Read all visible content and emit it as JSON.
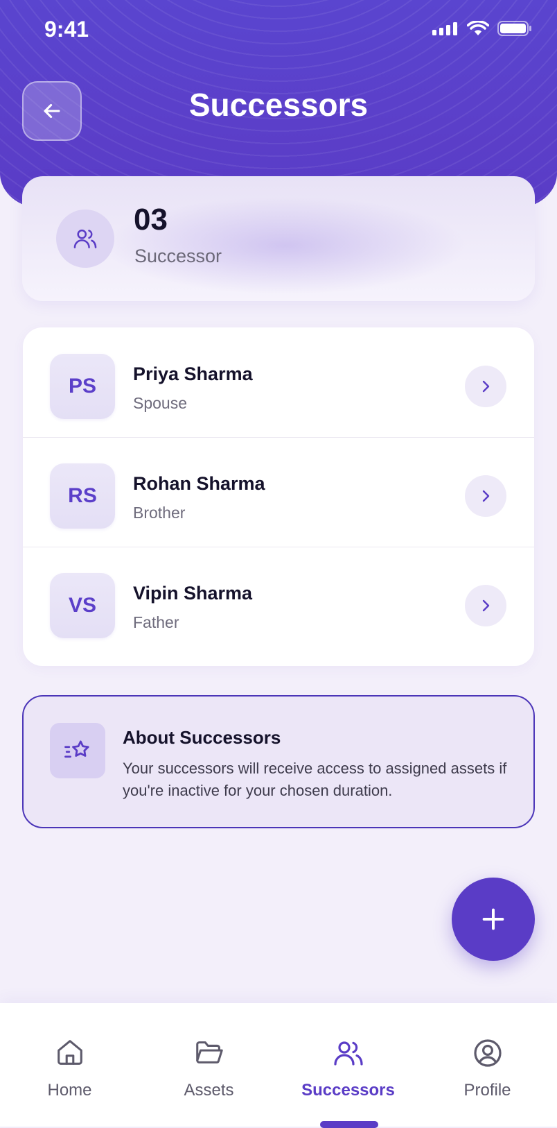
{
  "status_bar": {
    "time": "9:41"
  },
  "header": {
    "title": "Successors"
  },
  "summary": {
    "count": "03",
    "label": "Successor"
  },
  "successors": [
    {
      "initials": "PS",
      "name": "Priya Sharma",
      "relation": "Spouse"
    },
    {
      "initials": "RS",
      "name": "Rohan Sharma",
      "relation": "Brother"
    },
    {
      "initials": "VS",
      "name": "Vipin Sharma",
      "relation": "Father"
    }
  ],
  "about": {
    "title": "About Successors",
    "text": "Your successors will receive access to assigned assets if you're inactive for your chosen duration."
  },
  "tabs": [
    {
      "label": "Home",
      "icon": "home-icon"
    },
    {
      "label": "Assets",
      "icon": "folder-icon"
    },
    {
      "label": "Successors",
      "icon": "users-icon",
      "active": true
    },
    {
      "label": "Profile",
      "icon": "profile-icon"
    }
  ],
  "colors": {
    "primary": "#5a3cc6",
    "background": "#f3effa",
    "text": "#15122b"
  }
}
